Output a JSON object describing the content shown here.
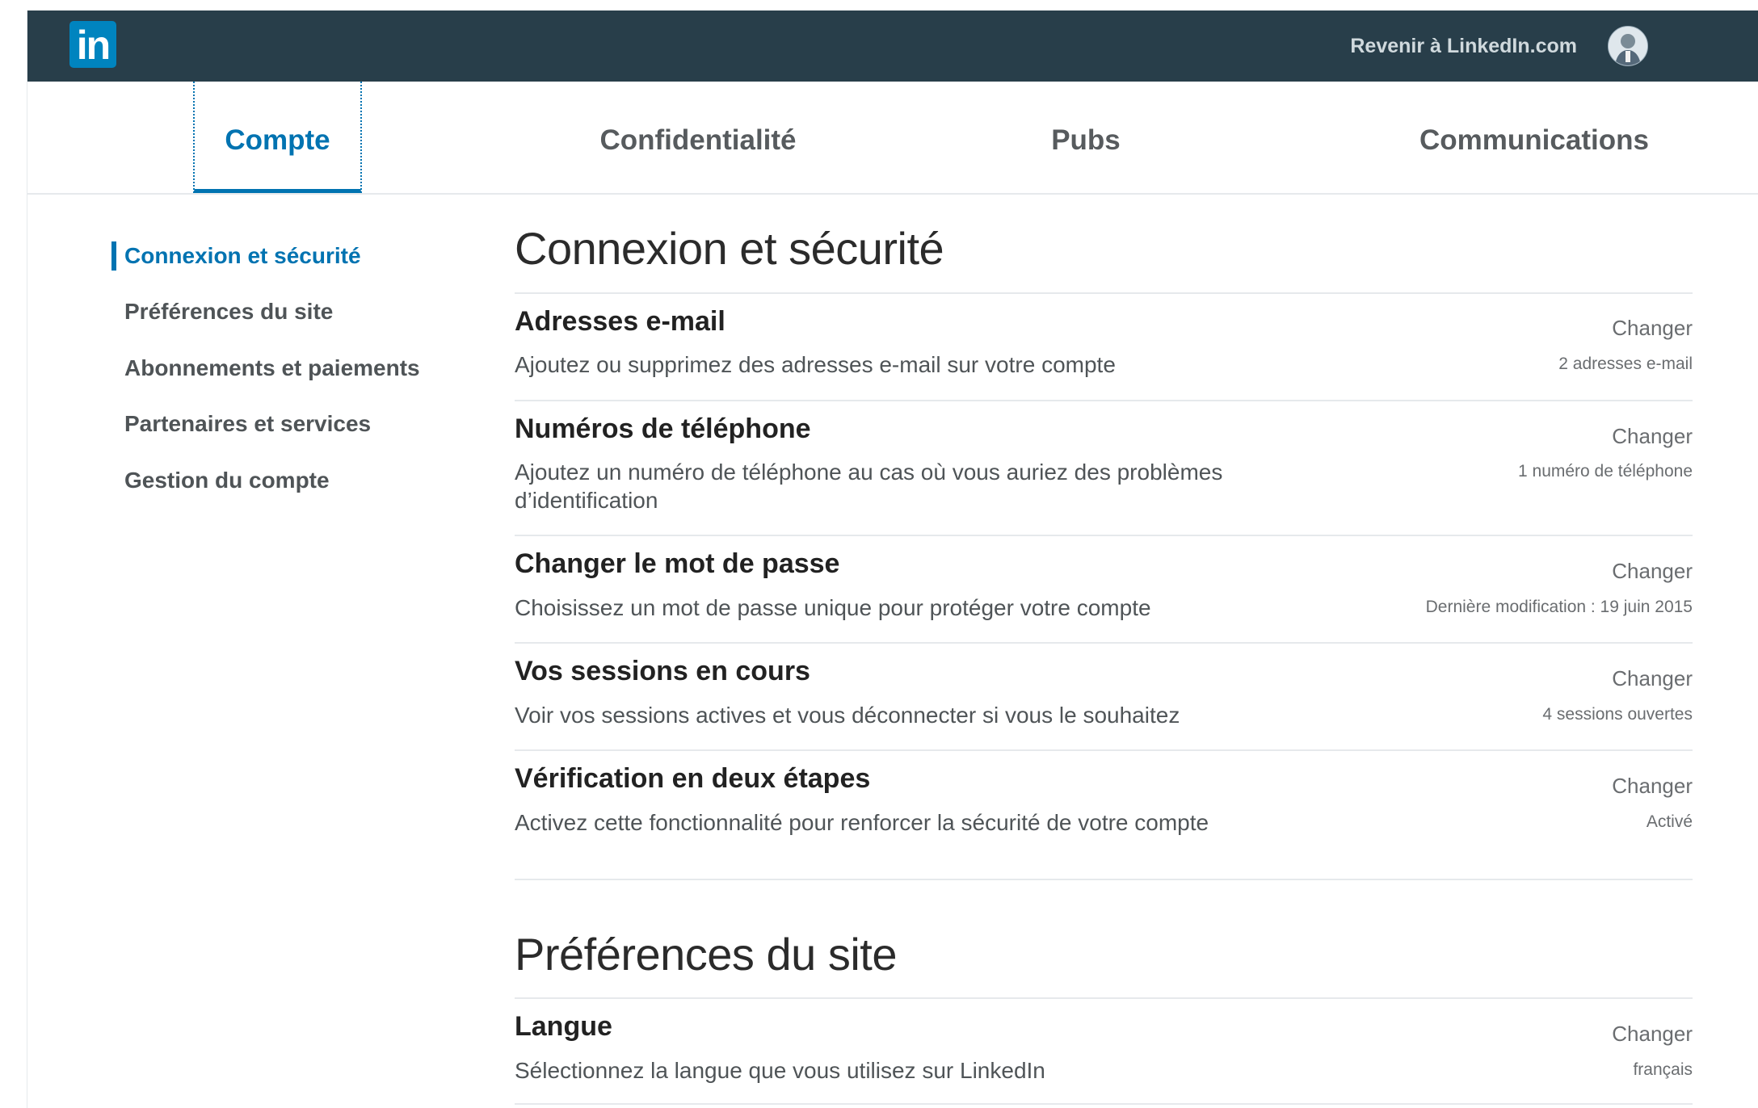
{
  "header": {
    "logo_text": "in",
    "back_link": "Revenir à LinkedIn.com"
  },
  "tabs": [
    {
      "label": "Compte",
      "active": true
    },
    {
      "label": "Confidentialité",
      "active": false
    },
    {
      "label": "Pubs",
      "active": false
    },
    {
      "label": "Communications",
      "active": false
    }
  ],
  "sidebar": {
    "items": [
      {
        "label": "Connexion et sécurité",
        "active": true
      },
      {
        "label": "Préférences du site",
        "active": false
      },
      {
        "label": "Abonnements et paiements",
        "active": false
      },
      {
        "label": "Partenaires et services",
        "active": false
      },
      {
        "label": "Gestion du compte",
        "active": false
      }
    ]
  },
  "sections": [
    {
      "title": "Connexion et sécurité",
      "rows": [
        {
          "title": "Adresses e-mail",
          "desc": "Ajoutez ou supprimez des adresses e-mail sur votre compte",
          "action": "Changer",
          "meta": "2 adresses e-mail"
        },
        {
          "title": "Numéros de téléphone",
          "desc": "Ajoutez un numéro de téléphone au cas où vous auriez des problèmes d’identification",
          "action": "Changer",
          "meta": "1 numéro de téléphone"
        },
        {
          "title": "Changer le mot de passe",
          "desc": "Choisissez un mot de passe unique pour protéger votre compte",
          "action": "Changer",
          "meta": "Dernière modification : 19 juin 2015"
        },
        {
          "title": "Vos sessions en cours",
          "desc": "Voir vos sessions actives et vous déconnecter si vous le souhaitez",
          "action": "Changer",
          "meta": "4 sessions ouvertes"
        },
        {
          "title": "Vérification en deux étapes",
          "desc": "Activez cette fonctionnalité pour renforcer la sécurité de votre compte",
          "action": "Changer",
          "meta": "Activé"
        }
      ]
    },
    {
      "title": "Préférences du site",
      "rows": [
        {
          "title": "Langue",
          "desc": "Sélectionnez la langue que vous utilisez sur LinkedIn",
          "action": "Changer",
          "meta": "français"
        }
      ]
    }
  ],
  "colors": {
    "topbar": "#283e4a",
    "accent": "#0073b1",
    "logo": "#0084bf"
  }
}
